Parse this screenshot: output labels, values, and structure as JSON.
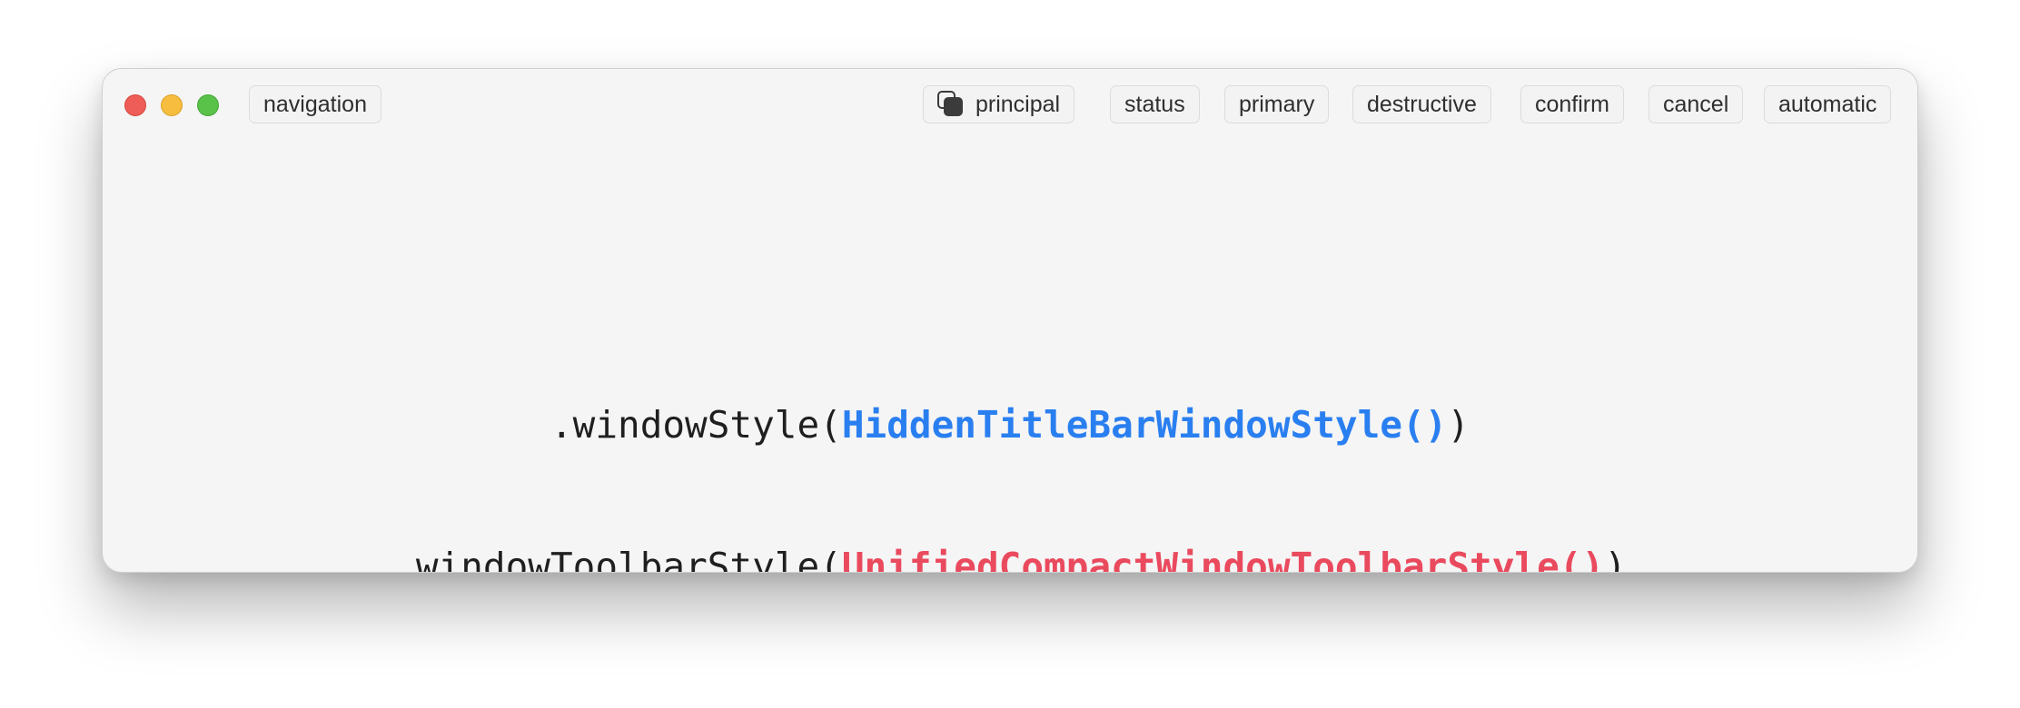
{
  "window": {
    "traffic_lights": [
      "close",
      "minimize",
      "zoom"
    ]
  },
  "toolbar": {
    "navigation_label": "navigation",
    "principal_label": "principal",
    "principal_icon": "stacked-squares-icon",
    "status_label": "status",
    "primary_label": "primary",
    "destructive_label": "destructive",
    "confirm_label": "confirm",
    "cancel_label": "cancel",
    "automatic_label": "automatic"
  },
  "content": {
    "line1": {
      "prefix": ".windowStyle(",
      "highlight": "HiddenTitleBarWindowStyle()",
      "suffix": ")"
    },
    "line2": {
      "prefix": ".windowToolbarStyle(",
      "highlight": "UnifiedCompactWindowToolbarStyle()",
      "suffix": ")"
    }
  },
  "colors": {
    "close": "#ee5d57",
    "minimize": "#f6bd3f",
    "zoom": "#5ac149",
    "highlight_blue": "#2a7ff0",
    "highlight_red": "#ea4a5e",
    "window_background": "#f5f5f5"
  }
}
